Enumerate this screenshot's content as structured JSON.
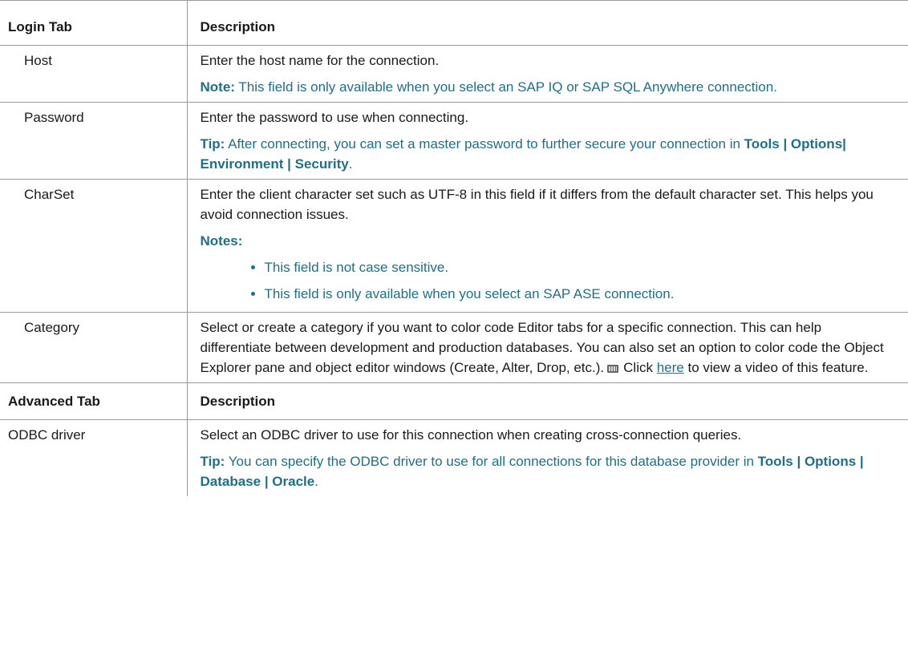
{
  "login_header": {
    "col1": "Login Tab",
    "col2": "Description"
  },
  "host": {
    "label": "Host",
    "desc": "Enter the host name for the connection.",
    "note_label": "Note:",
    "note_text": " This field is only available when you select an SAP IQ or SAP SQL Anywhere connection."
  },
  "password": {
    "label": "Password",
    "desc": "Enter the password to use when connecting.",
    "tip_label": "Tip:",
    "tip_text": " After connecting, you can set a master password to further secure your connection in ",
    "tip_path": "Tools | Options| Environment | Security",
    "tip_end": "."
  },
  "charset": {
    "label": "CharSet",
    "desc": "Enter the client character set such as UTF-8 in this field if it differs from the default character set. This helps you avoid connection issues.",
    "notes_label": "Notes:",
    "bullets": [
      "This field is not case sensitive.",
      "This field is only available when you select an SAP ASE connection."
    ]
  },
  "category": {
    "label": "Category",
    "desc": "Select or create a category if you want to color code Editor tabs for a specific connection. This can help differentiate between development and production databases. You can also set an option to color code the Object Explorer pane and object editor windows (Create, Alter, Drop, etc.).",
    "click": "Click ",
    "link": "here",
    "after_link": " to view a video of this feature.",
    "icon": "video-icon"
  },
  "advanced_header": {
    "col1": "Advanced Tab",
    "col2": "Description"
  },
  "odbc": {
    "label": "ODBC driver",
    "desc": "Select an ODBC driver to use for this connection when creating cross-connection queries.",
    "tip_label": "Tip:",
    "tip_text": " You can specify the ODBC driver to use for all connections for this database provider in ",
    "tip_path": "Tools | Options | Database | Oracle",
    "tip_end": "."
  }
}
